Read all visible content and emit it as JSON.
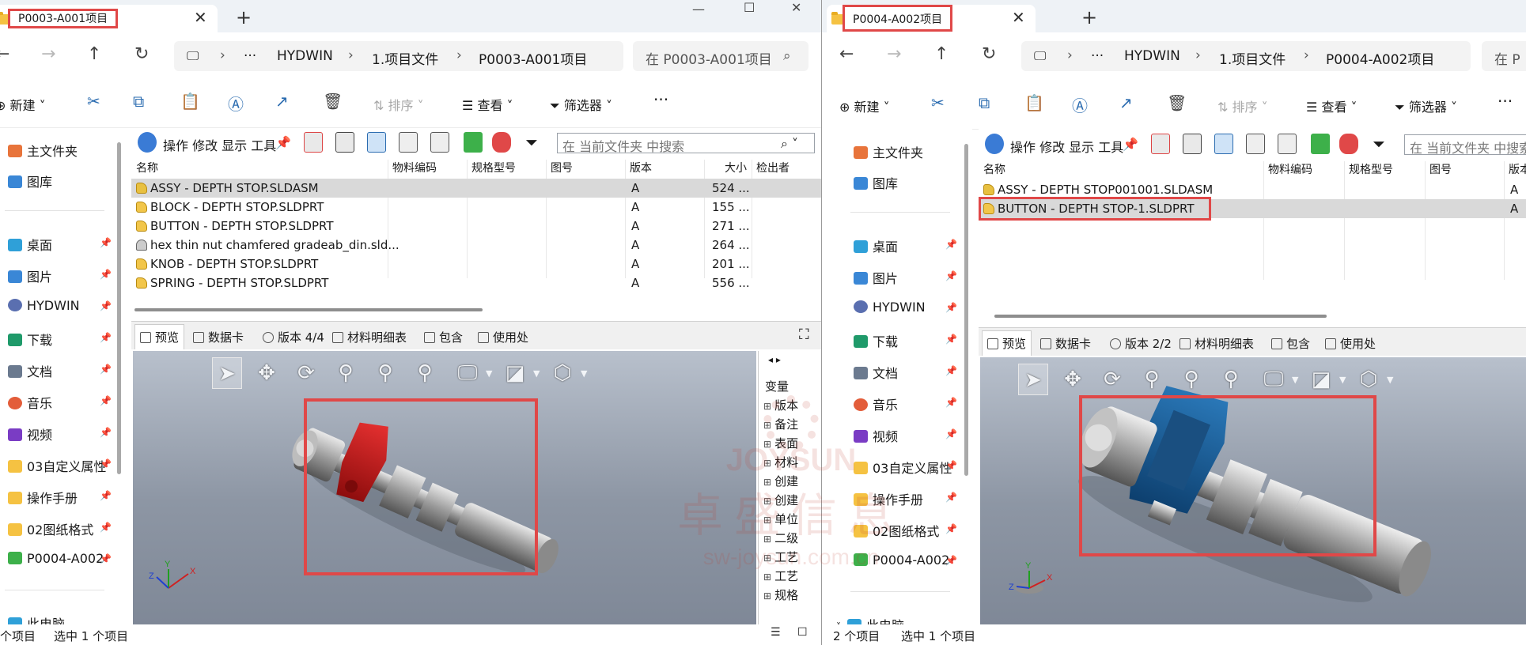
{
  "watermark": {
    "brand": "JOYSUN",
    "cn": "卓盛信息",
    "url": "sw-joysun.com.cn"
  },
  "left": {
    "tab_title": "P0003-A001项目",
    "breadcrumb": [
      "HYDWIN",
      "1.项目文件",
      "P0003-A001项目"
    ],
    "search_placeholder": "在 P0003-A001项目",
    "commands": {
      "new": "新建",
      "sort": "排序",
      "view": "查看",
      "filter": "筛选器",
      "more": "···"
    },
    "nav": {
      "home": "主文件夹",
      "gallery": "图库",
      "items": [
        "桌面",
        "图片",
        "HYDWIN",
        "下载",
        "文档",
        "音乐",
        "视频",
        "03自定义属性",
        "操作手册",
        "02图纸格式",
        "P0004-A002"
      ],
      "this_pc": "此电脑"
    },
    "pdm_toolbar_label": "操作 修改 显示 工具",
    "pdm_search_placeholder": "在 当前文件夹 中搜索",
    "columns": [
      "名称",
      "物料编码",
      "规格型号",
      "图号",
      "版本",
      "大小",
      "检出者"
    ],
    "rows": [
      {
        "name": "ASSY - DEPTH STOP.SLDASM",
        "version": "A",
        "size": "524 ..."
      },
      {
        "name": "BLOCK - DEPTH STOP.SLDPRT",
        "version": "A",
        "size": "155 ..."
      },
      {
        "name": "BUTTON - DEPTH STOP.SLDPRT",
        "version": "A",
        "size": "271 ..."
      },
      {
        "name": "hex thin nut chamfered gradeab_din.sld...",
        "version": "A",
        "size": "264 ..."
      },
      {
        "name": "KNOB - DEPTH STOP.SLDPRT",
        "version": "A",
        "size": "201 ..."
      },
      {
        "name": "SPRING - DEPTH STOP.SLDPRT",
        "version": "A",
        "size": "556 ..."
      }
    ],
    "preview_tabs": [
      "预览",
      "数据卡",
      "版本 4/4",
      "材料明细表",
      "包含",
      "使用处"
    ],
    "variables": {
      "header": "变量",
      "items": [
        "版本",
        "备注",
        "表面",
        "材料",
        "创建",
        "创建",
        "单位",
        "二级",
        "工艺",
        "工艺",
        "规格"
      ]
    },
    "status": {
      "count": "个项目",
      "selected": "选中 1 个项目"
    }
  },
  "right": {
    "tab_title": "P0004-A002项目",
    "breadcrumb": [
      "HYDWIN",
      "1.项目文件",
      "P0004-A002项目"
    ],
    "search_placeholder": "在 P",
    "commands": {
      "new": "新建",
      "sort": "排序",
      "view": "查看",
      "filter": "筛选器",
      "more": "···"
    },
    "nav": {
      "home": "主文件夹",
      "gallery": "图库",
      "items": [
        "桌面",
        "图片",
        "HYDWIN",
        "下载",
        "文档",
        "音乐",
        "视频",
        "03自定义属性",
        "操作手册",
        "02图纸格式",
        "P0004-A002"
      ],
      "this_pc": "此电脑"
    },
    "pdm_toolbar_label": "操作 修改 显示 工具",
    "pdm_search_placeholder": "在 当前文件夹 中搜索",
    "columns": [
      "名称",
      "物料编码",
      "规格型号",
      "图号",
      "版本"
    ],
    "rows": [
      {
        "name": "ASSY - DEPTH STOP001001.SLDASM",
        "version": "A"
      },
      {
        "name": "BUTTON - DEPTH STOP-1.SLDPRT",
        "version": "A"
      }
    ],
    "preview_tabs": [
      "预览",
      "数据卡",
      "版本 2/2",
      "材料明细表",
      "包含",
      "使用处"
    ],
    "status": {
      "count": "2 个项目",
      "selected": "选中 1 个项目"
    }
  },
  "colors": {
    "highlight": "#e04848",
    "accent": "#2b6cb0",
    "folder": "#f5c242"
  }
}
